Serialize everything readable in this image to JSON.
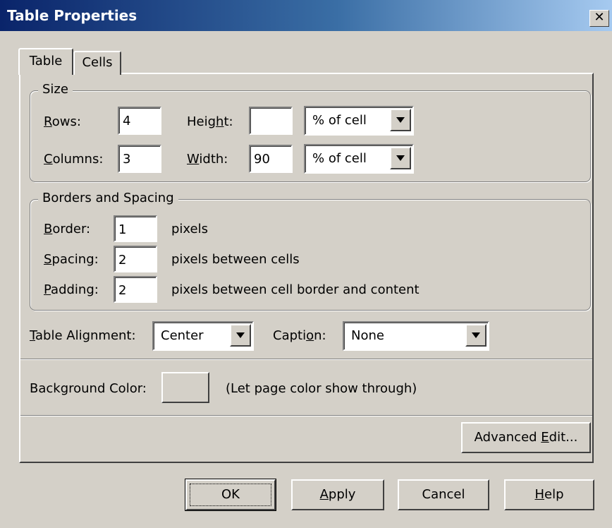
{
  "window": {
    "title": "Table Properties",
    "close_glyph": "✕",
    "close_icon": "close-icon",
    "title_bar_colors": [
      "#0a246a",
      "#a6caf0"
    ]
  },
  "tabs": [
    {
      "label": "Table",
      "selected": true
    },
    {
      "label": "Cells",
      "selected": false
    }
  ],
  "size_group": {
    "title": "Size",
    "rows": {
      "label_first": "R",
      "label_rest": "ows:",
      "value": "4"
    },
    "columns": {
      "label_first": "C",
      "label_rest": "olumns:",
      "value": "3"
    },
    "height": {
      "label_pre": "Heig",
      "label_u": "h",
      "label_post": "t:",
      "value": "",
      "unit": "% of cell"
    },
    "width": {
      "label_first": "W",
      "label_rest": "idth:",
      "value": "90",
      "unit": "% of cell"
    }
  },
  "borders_group": {
    "title": "Borders and Spacing",
    "border": {
      "label_first": "B",
      "label_rest": "order:",
      "value": "1",
      "suffix": "pixels"
    },
    "spacing": {
      "label_first": "S",
      "label_rest": "pacing:",
      "value": "2",
      "suffix": "pixels between cells"
    },
    "padding": {
      "label_first": "P",
      "label_rest": "adding:",
      "value": "2",
      "suffix": "pixels between cell border and content"
    }
  },
  "alignment": {
    "label_first": "T",
    "label_rest": "able Alignment:",
    "value": "Center"
  },
  "caption": {
    "label_pre": "Capti",
    "label_u": "o",
    "label_post": "n:",
    "value": "None"
  },
  "background": {
    "label": "Background Color:",
    "note": "(Let page color show through)"
  },
  "advanced_button": {
    "label_pre": "Advanced ",
    "label_u": "E",
    "label_post": "dit..."
  },
  "buttons": {
    "ok": "OK",
    "apply_u": "A",
    "apply_rest": "pply",
    "cancel": "Cancel",
    "help_u": "H",
    "help_rest": "elp"
  }
}
